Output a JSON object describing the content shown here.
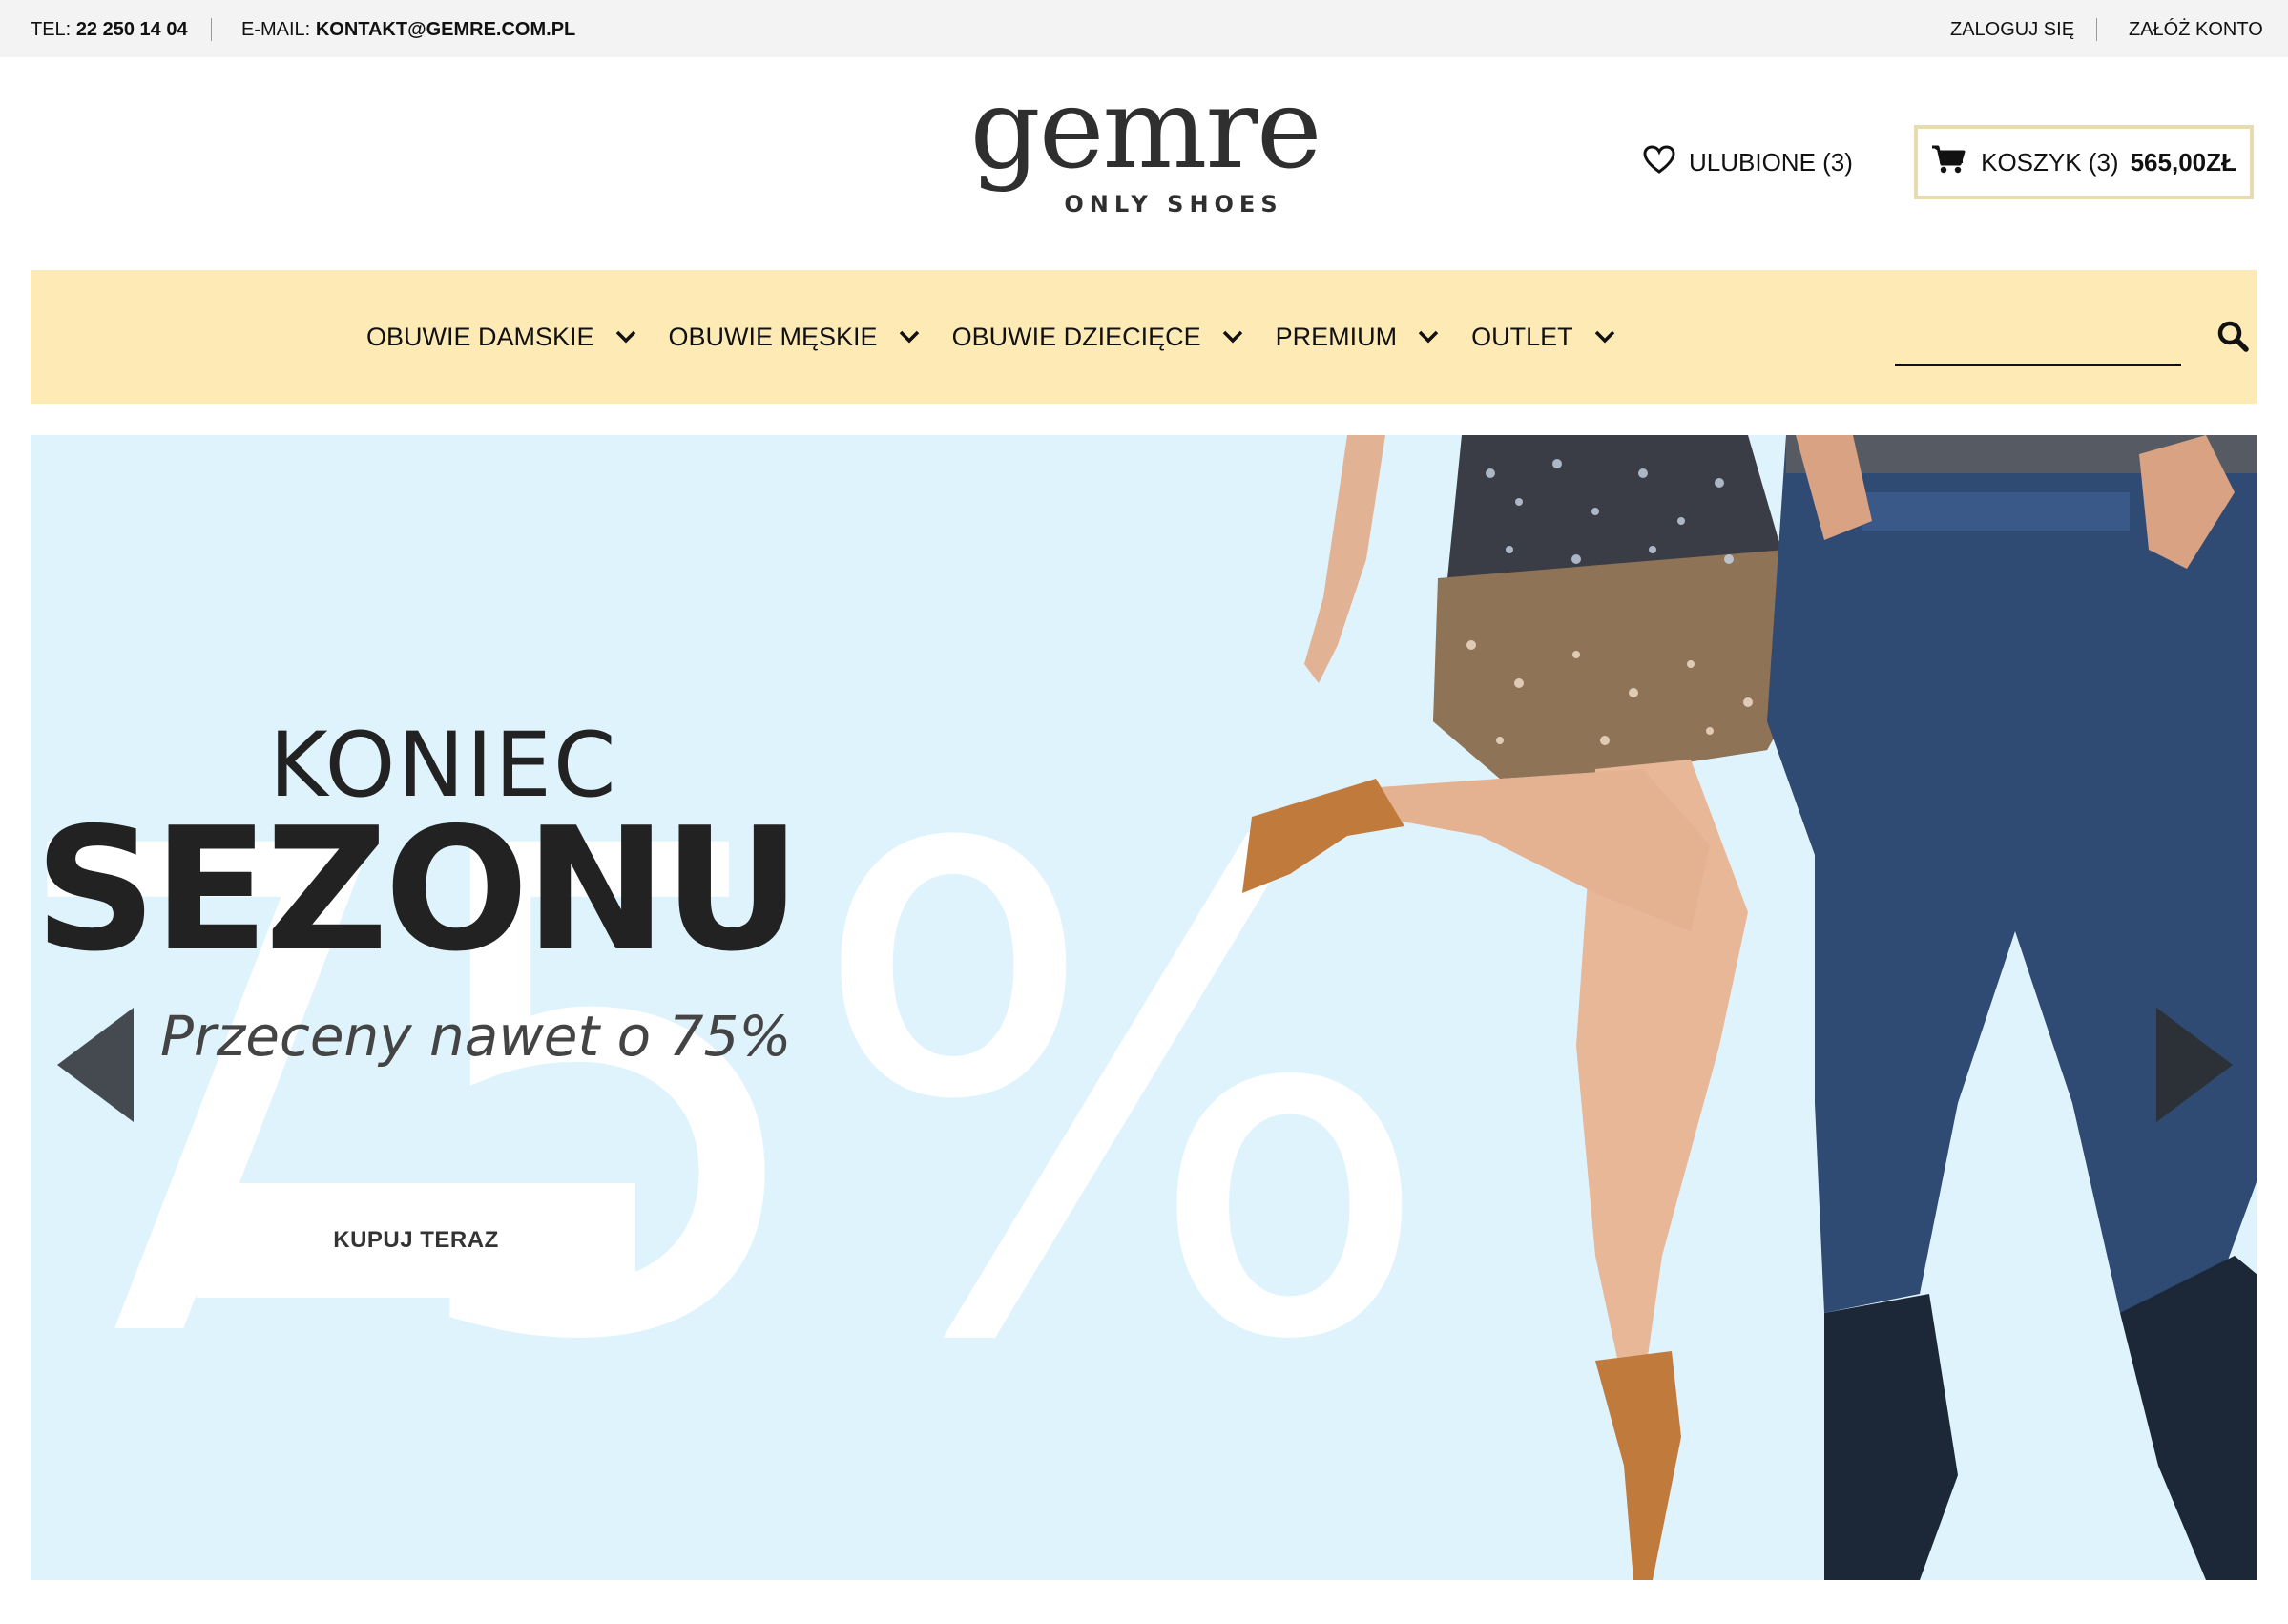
{
  "topbar": {
    "tel_label": "TEL:",
    "tel_value": "22 250 14 04",
    "email_label": "E-MAIL:",
    "email_value": "KONTAKT@GEMRE.COM.PL",
    "login": "ZALOGUJ SIĘ",
    "register": "ZAŁÓŻ KONTO"
  },
  "header": {
    "logo_word": "gemre",
    "logo_tagline": "ONLY SHOES",
    "favorites": "ULUBIONE (3)",
    "cart_label": "KOSZYK (3)",
    "cart_total": "565,00ZŁ"
  },
  "nav": {
    "items": [
      {
        "label": "OBUWIE DAMSKIE"
      },
      {
        "label": "OBUWIE MĘSKIE"
      },
      {
        "label": "OBUWIE DZIECIĘCE"
      },
      {
        "label": "PREMIUM"
      },
      {
        "label": "OUTLET"
      }
    ],
    "search_placeholder": ""
  },
  "hero": {
    "background_number": "75%",
    "line1": "KONIEC",
    "line2": "SEZONU",
    "subtitle": "Przeceny nawet o 75%",
    "cta": "KUPUJ TERAZ"
  },
  "colors": {
    "topbar_bg": "#f3f3f3",
    "nav_bg": "#fdeab5",
    "hero_bg": "#dff3fd",
    "cart_border": "#e8dcae",
    "text_dark": "#222222"
  },
  "icons": {
    "favorites": "heart-icon",
    "cart": "cart-icon",
    "dropdown": "chevron-down-icon",
    "search": "search-icon",
    "prev": "arrow-left-icon",
    "next": "arrow-right-icon"
  }
}
